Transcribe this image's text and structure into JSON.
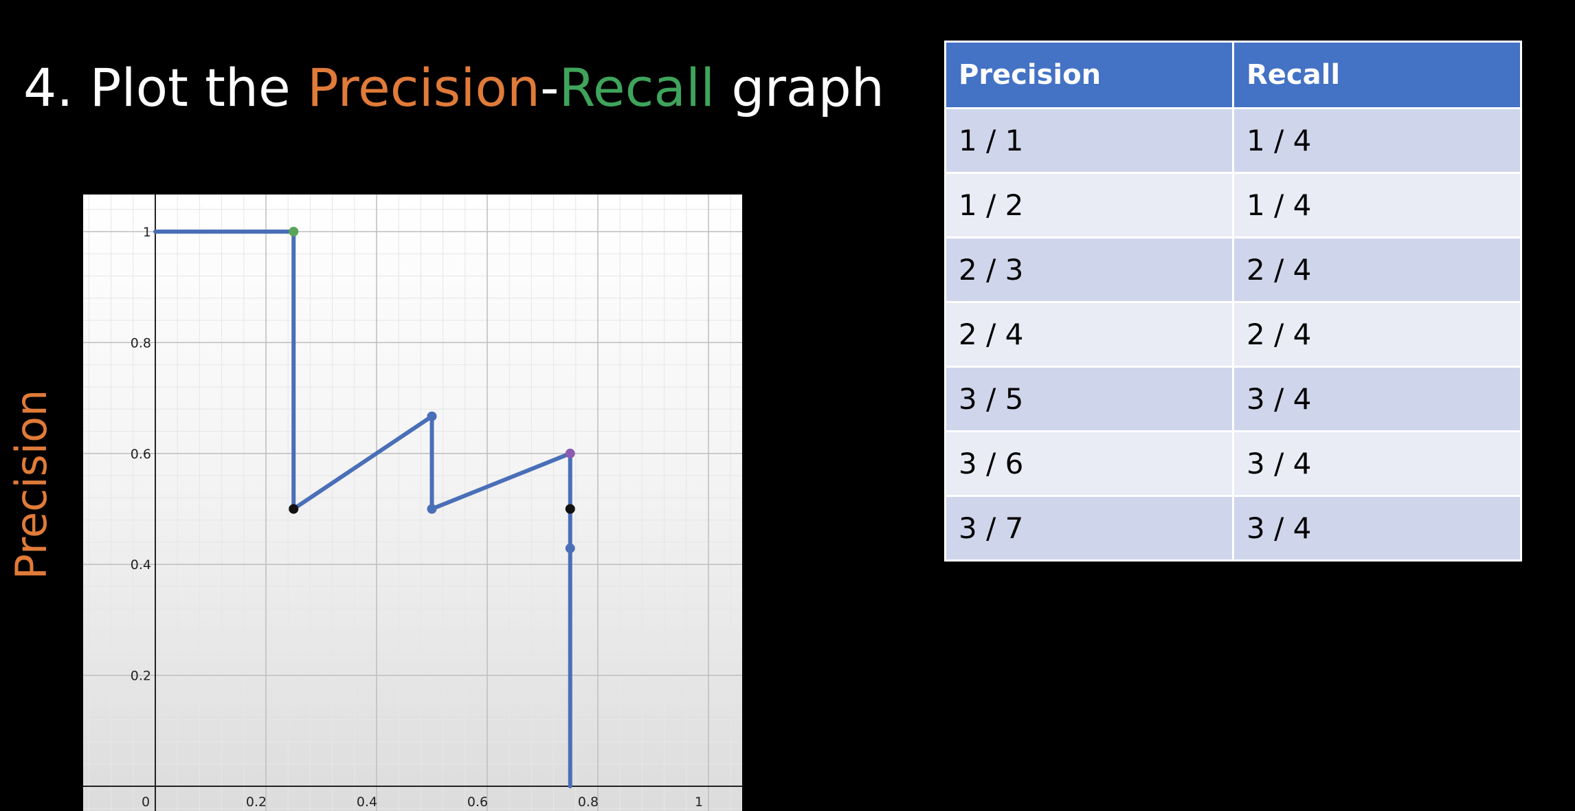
{
  "slide": {
    "title_prefix": "4. Plot the ",
    "title_precision": "Precision",
    "title_dash": "-",
    "title_recall": "Recall",
    "title_suffix": " graph"
  },
  "colors": {
    "precision": "#e07b39",
    "recall": "#3fa45b",
    "line": "#4a6fb8",
    "header": "#4472c4"
  },
  "table": {
    "headers": [
      "Precision",
      "Recall"
    ],
    "rows": [
      [
        "1 / 1",
        "1 / 4"
      ],
      [
        "1 / 2",
        "1 / 4"
      ],
      [
        "2 / 3",
        "2 / 4"
      ],
      [
        "2 / 4",
        "2 / 4"
      ],
      [
        "3 / 5",
        "3 / 4"
      ],
      [
        "3 / 6",
        "3 / 4"
      ],
      [
        "3 / 7",
        "3 / 4"
      ]
    ]
  },
  "chart_data": {
    "type": "line",
    "ylabel": "Precision",
    "xlabel": "",
    "xlim": [
      0,
      1
    ],
    "ylim": [
      0,
      1
    ],
    "xticks": [
      0,
      0.2,
      0.4,
      0.6,
      0.8,
      1
    ],
    "yticks": [
      0.2,
      0.4,
      0.6,
      0.8,
      1
    ],
    "xtick_labels": [
      "0",
      "0.2",
      "0.4",
      "0.6",
      "0.8",
      "1"
    ],
    "ytick_labels": [
      "0.2",
      "0.4",
      "0.6",
      "0.8",
      "1"
    ],
    "grid": true,
    "series": [
      {
        "x": [
          0,
          0.25,
          0.25,
          0.5,
          0.5,
          0.75,
          0.75,
          0.75,
          0.75
        ],
        "y": [
          1,
          1,
          0.5,
          0.667,
          0.5,
          0.6,
          0.5,
          0.429,
          0
        ]
      }
    ],
    "points": [
      {
        "x": 0.25,
        "y": 1,
        "color": "#5aa55a"
      },
      {
        "x": 0.25,
        "y": 0.5,
        "color": "#111111"
      },
      {
        "x": 0.5,
        "y": 0.667,
        "color": "#4a6fb8"
      },
      {
        "x": 0.5,
        "y": 0.5,
        "color": "#4a6fb8"
      },
      {
        "x": 0.75,
        "y": 0.6,
        "color": "#8a5bb0"
      },
      {
        "x": 0.75,
        "y": 0.5,
        "color": "#111111"
      },
      {
        "x": 0.75,
        "y": 0.429,
        "color": "#4a6fb8"
      }
    ]
  }
}
